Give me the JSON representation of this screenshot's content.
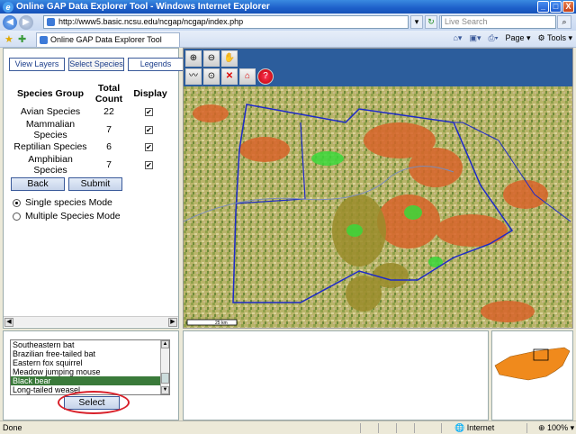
{
  "window": {
    "title": "Online GAP Data Explorer Tool - Windows Internet Explorer",
    "controls": [
      "_",
      "□",
      "X"
    ]
  },
  "browser": {
    "address": "http://www5.basic.ncsu.edu/ncgap/ncgap/index.php",
    "search_placeholder": "Live Search",
    "tab_title": "Online GAP Data Explorer Tool",
    "commands": {
      "page": "Page",
      "tools": "Tools"
    }
  },
  "left_panel": {
    "tabs": [
      "View Layers",
      "Select Species",
      "Legends"
    ],
    "active_tab": "Select Species",
    "headers": {
      "group": "Species Group",
      "count": "Total Count",
      "display": "Display"
    },
    "rows": [
      {
        "group": "Avian Species",
        "count": "22",
        "checked": true
      },
      {
        "group": "Mammalian Species",
        "count": "7",
        "checked": true
      },
      {
        "group": "Reptilian Species",
        "count": "6",
        "checked": true
      },
      {
        "group": "Amphibian Species",
        "count": "7",
        "checked": true
      }
    ],
    "buttons": {
      "back": "Back",
      "submit": "Submit"
    },
    "modes": {
      "single": "Single species Mode",
      "multiple": "Multiple Species Mode",
      "selected": "single"
    }
  },
  "species_list": {
    "items": [
      "Southeastern bat",
      "Brazilian free-tailed bat",
      "Eastern fox squirrel",
      "Meadow jumping mouse",
      "Black bear",
      "Long-tailed weasel"
    ],
    "selected": "Black bear",
    "select_button": "Select"
  },
  "map": {
    "scale_label": "25 km",
    "tools": [
      "zoom-in-icon",
      "zoom-out-icon",
      "pan-hand-icon",
      "measure-icon",
      "zoom-extent-icon",
      "clear-icon",
      "home-icon",
      "help-icon"
    ]
  },
  "status": {
    "left": "Done",
    "zone": "Internet",
    "zoom": "100%"
  },
  "colors": {
    "title_bar": "#1d5fc9",
    "map_toolbar": "#2c5d9c",
    "selection": "#3a7a3a",
    "highlight_oval": "#d8202a"
  }
}
